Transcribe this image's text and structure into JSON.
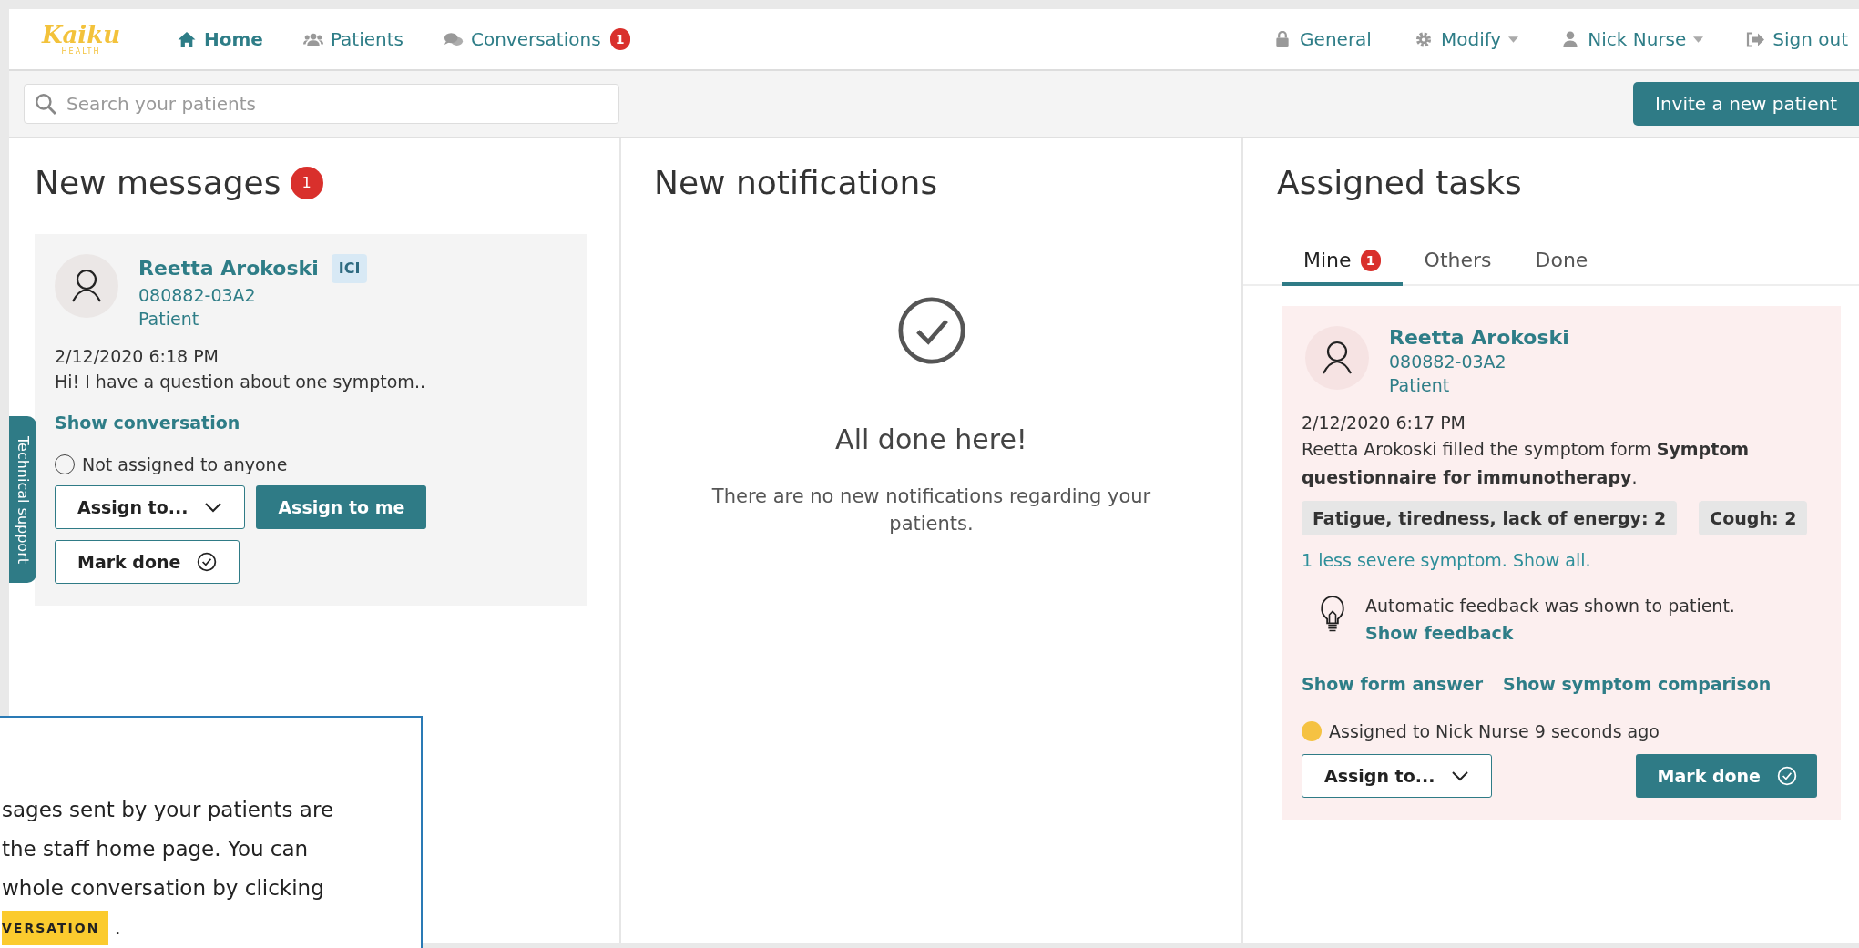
{
  "nav": {
    "logo": "Kaiku",
    "logo_sub": "HEALTH",
    "items": [
      {
        "label": "Home",
        "kind": "home",
        "selected": true
      },
      {
        "label": "Patients",
        "kind": "users",
        "selected": false
      },
      {
        "label": "Conversations",
        "kind": "chat",
        "selected": false,
        "badge": "1"
      }
    ],
    "right": [
      {
        "label": "General",
        "kind": "lock",
        "dropdown": false
      },
      {
        "label": "Modify",
        "kind": "gear",
        "dropdown": true
      },
      {
        "label": "Nick Nurse",
        "kind": "user",
        "dropdown": true
      },
      {
        "label": "Sign out",
        "kind": "signout",
        "dropdown": false
      }
    ]
  },
  "search": {
    "placeholder": "Search your patients"
  },
  "invite_button": "Invite a new patient",
  "technical_support": "Technical support",
  "messages": {
    "title": "New messages",
    "badge": "1",
    "cards": [
      {
        "name": "Reetta Arokoski",
        "tag": "ICI",
        "id": "080882-03A2",
        "role": "Patient",
        "time": "2/12/2020 6:18 PM",
        "text": "Hi! I have a question about one symptom..",
        "link": "Show conversation",
        "assignment": "Not assigned to anyone",
        "assign_dropdown": "Assign to...",
        "assign_me": "Assign to me",
        "mark_done": "Mark done"
      }
    ]
  },
  "notifications": {
    "title": "New notifications",
    "empty_title": "All done here!",
    "empty_text": "There are no new notifications regarding your patients."
  },
  "tasks": {
    "title": "Assigned tasks",
    "tabs": [
      {
        "label": "Mine",
        "badge": "1",
        "selected": true
      },
      {
        "label": "Others",
        "selected": false
      },
      {
        "label": "Done",
        "selected": false
      }
    ],
    "cards": [
      {
        "name": "Reetta Arokoski",
        "id": "080882-03A2",
        "role": "Patient",
        "time": "2/12/2020 6:17 PM",
        "text": "Reetta Arokoski filled the symptom form **Symptom questionnaire for immunotherapy**.",
        "symptoms": [
          "Fatigue, tiredness, lack of energy: 2",
          "Cough: 2"
        ],
        "more_link": "1 less severe symptom. Show all.",
        "feedback_text": "Automatic feedback was shown to patient.",
        "feedback_link": "Show feedback",
        "links": [
          "Show form answer",
          "Show symptom comparison"
        ],
        "assignment": "Assigned to Nick Nurse 9 seconds ago",
        "color": "#f5c242",
        "assign_dropdown": "Assign to...",
        "mark_done": "Mark done"
      }
    ]
  },
  "tour_tooltip": {
    "lines": [
      "sages sent by your patients are",
      "the staff home page. You can",
      "whole conversation by clicking"
    ],
    "chip": "VERSATION",
    "end": "."
  }
}
